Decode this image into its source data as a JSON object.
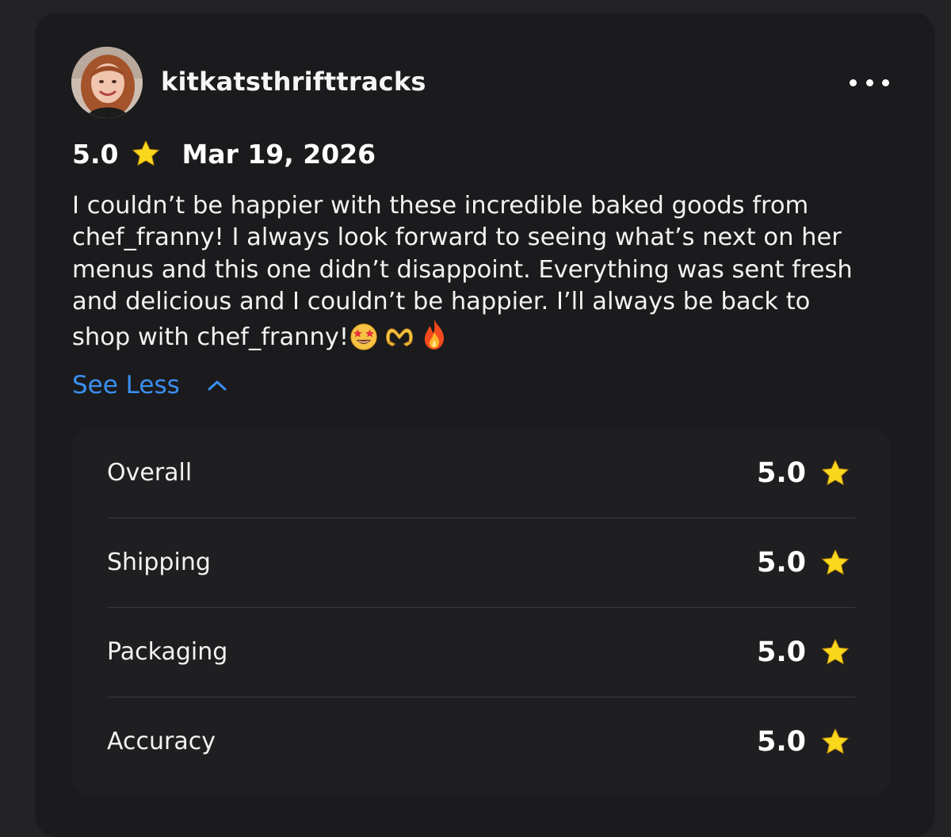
{
  "reviewer": {
    "username": "kitkatsthrifttracks",
    "avatar_icon": "user-avatar"
  },
  "menu": {
    "icon": "more-horizontal-icon"
  },
  "review": {
    "rating": "5.0",
    "date": "Mar 19, 2026",
    "lines": [
      "I couldn’t be happier with these incredible baked goods from",
      "chef_franny! I always look forward to seeing what’s next on her",
      "menus and this one didn’t disappoint. Everything was sent fresh",
      "and delicious and I couldn’t be happier. I’ll always be back to",
      "shop with chef_franny!"
    ],
    "emojis": [
      "star-struck-emoji",
      "heart-hands-emoji",
      "fire-emoji"
    ],
    "see_less_label": "See Less"
  },
  "breakdown": [
    {
      "label": "Overall",
      "value": "5.0"
    },
    {
      "label": "Shipping",
      "value": "5.0"
    },
    {
      "label": "Packaging",
      "value": "5.0"
    },
    {
      "label": "Accuracy",
      "value": "5.0"
    }
  ],
  "colors": {
    "background": "#232325",
    "card": "#1b1b1d",
    "panel": "#1f1f21",
    "link": "#3b8ff0",
    "star": "#f9d71c",
    "text": "#ffffff"
  }
}
